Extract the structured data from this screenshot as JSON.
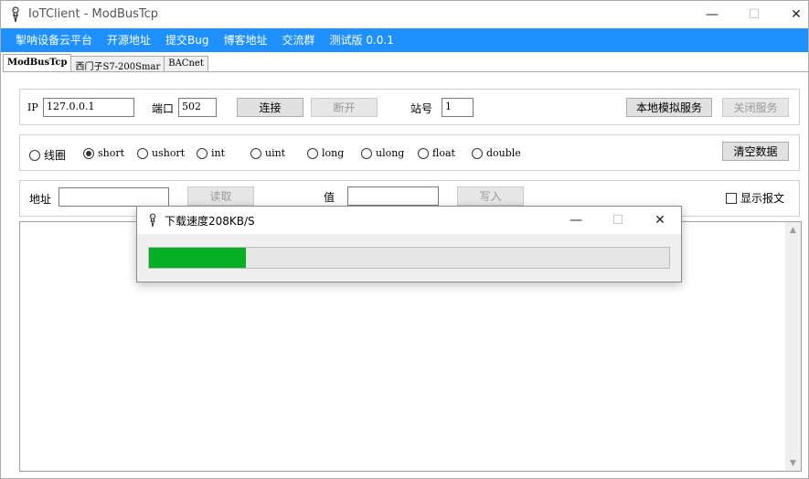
{
  "window": {
    "title": "IoTClient - ModBusTcp",
    "min_glyph": "—",
    "max_glyph": "☐",
    "close_glyph": "✕"
  },
  "menu": [
    "掣呐设备云平台",
    "开源地址",
    "提交Bug",
    "博客地址",
    "交流群",
    "测试版 0.0.1"
  ],
  "tabs": [
    "ModBusTcp",
    "西门子S7-200Smar",
    "BACnet"
  ],
  "connection": {
    "ip_label": "IP",
    "ip_value": "127.0.0.1",
    "port_label": "端口",
    "port_value": "502",
    "connect_label": "连接",
    "disconnect_label": "断开",
    "station_label": "站号",
    "station_value": "1",
    "local_sim_label": "本地模拟服务",
    "close_service_label": "关闭服务"
  },
  "datatypes": {
    "options": [
      "线圈",
      "short",
      "ushort",
      "int",
      "uint",
      "long",
      "ulong",
      "float",
      "double"
    ],
    "selected": "short",
    "clear_label": "清空数据"
  },
  "readwrite": {
    "address_label": "地址",
    "address_value": "",
    "read_label": "读取",
    "value_label": "值",
    "value_value": "",
    "write_label": "写入",
    "show_packet_label": "显示报文",
    "show_packet_checked": false
  },
  "dialog": {
    "title": "下载速度208KB/S",
    "progress_fraction": 0.187,
    "progress_color": "#06b025"
  },
  "scroll": {
    "up_glyph": "▲",
    "down_glyph": "▼"
  }
}
